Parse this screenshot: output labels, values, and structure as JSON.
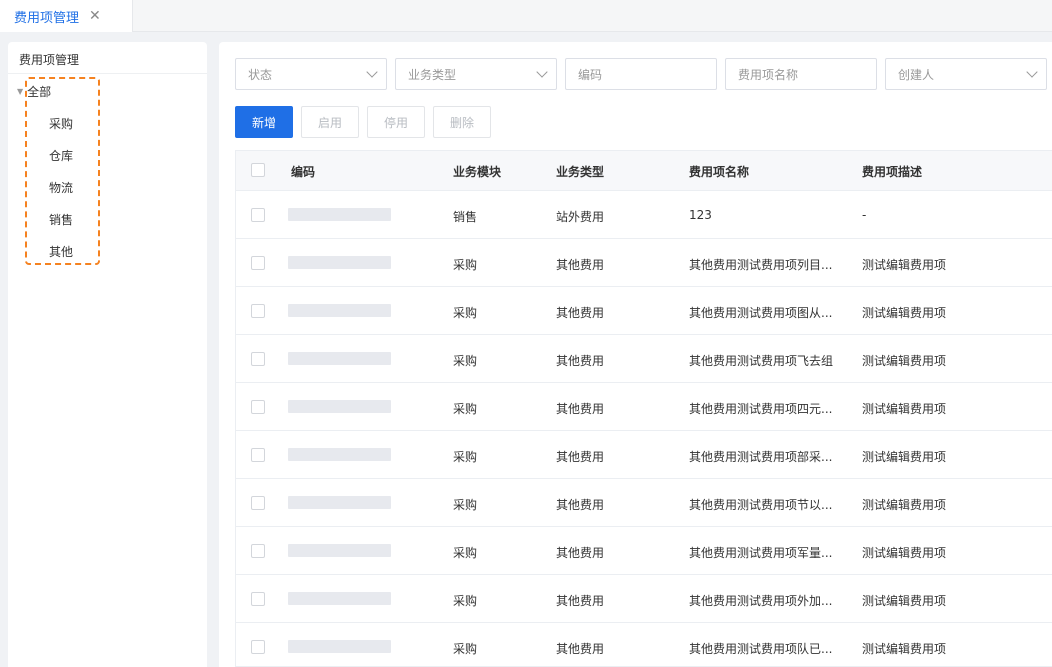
{
  "tabs": [
    {
      "label": "费用项管理",
      "close_icon": "close-icon"
    }
  ],
  "sidebar": {
    "title": "费用项管理",
    "tree": {
      "root": "全部",
      "children": [
        "采购",
        "仓库",
        "物流",
        "销售",
        "其他"
      ]
    }
  },
  "filters": {
    "status": "状态",
    "business_type": "业务类型",
    "code": "编码",
    "fee_name": "费用项名称",
    "creator": "创建人"
  },
  "toolbar": {
    "add": "新增",
    "enable": "启用",
    "disable": "停用",
    "delete": "删除"
  },
  "table": {
    "columns": [
      "编码",
      "业务模块",
      "业务类型",
      "费用项名称",
      "费用项描述"
    ],
    "rows": [
      [
        "销售",
        "站外费用",
        "123",
        "-"
      ],
      [
        "采购",
        "其他费用",
        "其他费用测试费用项列目...",
        "测试编辑费用项"
      ],
      [
        "采购",
        "其他费用",
        "其他费用测试费用项图从...",
        "测试编辑费用项"
      ],
      [
        "采购",
        "其他费用",
        "其他费用测试费用项飞去组",
        "测试编辑费用项"
      ],
      [
        "采购",
        "其他费用",
        "其他费用测试费用项四元...",
        "测试编辑费用项"
      ],
      [
        "采购",
        "其他费用",
        "其他费用测试费用项部采...",
        "测试编辑费用项"
      ],
      [
        "采购",
        "其他费用",
        "其他费用测试费用项节以...",
        "测试编辑费用项"
      ],
      [
        "采购",
        "其他费用",
        "其他费用测试费用项军量...",
        "测试编辑费用项"
      ],
      [
        "采购",
        "其他费用",
        "其他费用测试费用项外加...",
        "测试编辑费用项"
      ],
      [
        "采购",
        "其他费用",
        "其他费用测试费用项队已...",
        "测试编辑费用项"
      ]
    ]
  },
  "colors": {
    "primary": "#1f6fe6",
    "highlight": "#f58220"
  }
}
